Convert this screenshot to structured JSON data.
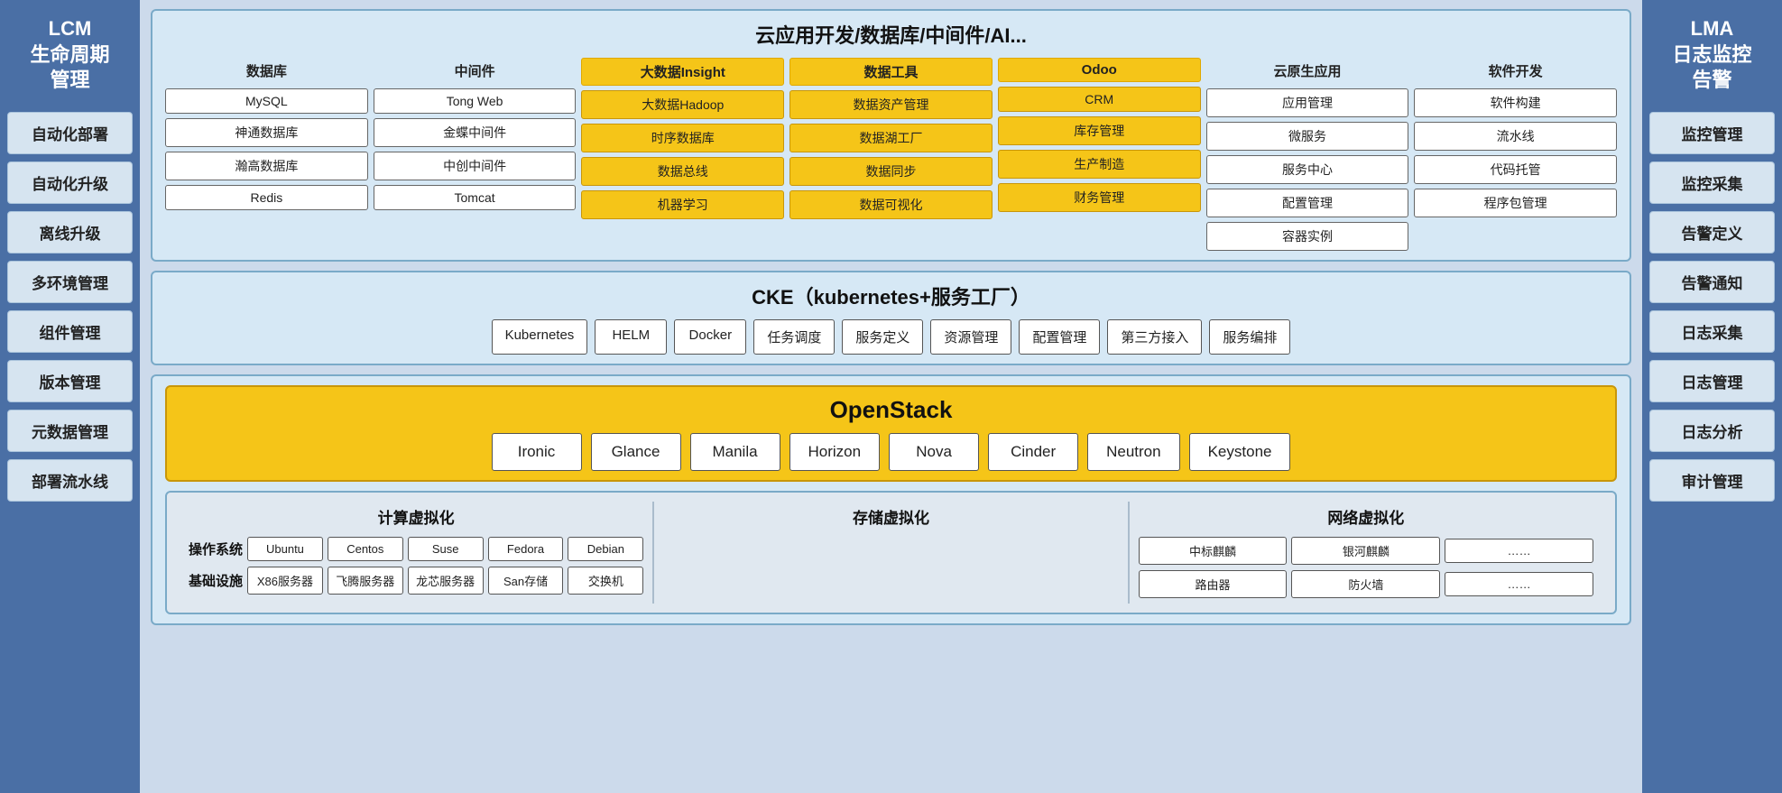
{
  "sidebar_left": {
    "title": "LCM\n生命周期\n管理",
    "items": [
      "自动化部署",
      "自动化升级",
      "离线升级",
      "多环境管理",
      "组件管理",
      "版本管理",
      "元数据管理",
      "部署流水线"
    ]
  },
  "sidebar_right": {
    "title": "LMA\n日志监控\n告警",
    "items": [
      "监控管理",
      "监控采集",
      "告警定义",
      "告警通知",
      "日志采集",
      "日志管理",
      "日志分析",
      "审计管理"
    ]
  },
  "cloud_section": {
    "title": "云应用开发/数据库/中间件/AI...",
    "columns": [
      {
        "header": "数据库",
        "header_yellow": false,
        "items": [
          "MySQL",
          "神通数据库",
          "瀚高数据库",
          "Redis"
        ]
      },
      {
        "header": "中间件",
        "header_yellow": false,
        "items": [
          "Tong Web",
          "金蝶中间件",
          "中创中间件",
          "Tomcat"
        ]
      },
      {
        "header": "大数据Insight",
        "header_yellow": true,
        "items": [
          "大数据Hadoop",
          "时序数据库",
          "数据总线",
          "机器学习"
        ],
        "items_yellow": true
      },
      {
        "header": "数据工具",
        "header_yellow": true,
        "items": [
          "数据资产管理",
          "数据湖工厂",
          "数据同步",
          "数据可视化"
        ],
        "items_yellow": true
      },
      {
        "header": "Odoo",
        "header_yellow": true,
        "items": [
          "CRM",
          "库存管理",
          "生产制造",
          "财务管理"
        ],
        "items_yellow": true
      },
      {
        "header": "云原生应用",
        "header_yellow": false,
        "items": [
          "应用管理",
          "微服务",
          "服务中心",
          "配置管理",
          "容器实例"
        ]
      },
      {
        "header": "软件开发",
        "header_yellow": false,
        "items": [
          "软件构建",
          "流水线",
          "代码托管",
          "程序包管理"
        ]
      }
    ]
  },
  "cke_section": {
    "title": "CKE（kubernetes+服务工厂）",
    "items": [
      "Kubernetes",
      "HELM",
      "Docker",
      "任务调度",
      "服务定义",
      "资源管理",
      "配置管理",
      "第三方接入",
      "服务编排"
    ]
  },
  "openstack_section": {
    "title": "OpenStack",
    "items": [
      "Ironic",
      "Glance",
      "Manila",
      "Horizon",
      "Nova",
      "Cinder",
      "Neutron",
      "Keystone"
    ]
  },
  "virt_section": {
    "columns": [
      {
        "title": "计算虚拟化",
        "os_label": "操作系统",
        "infra_label": "基础设施",
        "os_items": [
          "Ubuntu",
          "Centos",
          "Suse",
          "Fedora",
          "Debian"
        ],
        "infra_items": [
          "X86服务器",
          "飞腾服务器",
          "龙芯服务器",
          "San存储",
          "交换机"
        ]
      },
      {
        "title": "存储虚拟化",
        "os_label": "",
        "infra_label": "",
        "os_items": [],
        "infra_items": []
      },
      {
        "title": "网络虚拟化",
        "os_label": "",
        "infra_label": "",
        "os_items": [
          "中标麒麟",
          "银河麒麟",
          "……"
        ],
        "infra_items": [
          "路由器",
          "防火墙",
          "……"
        ]
      }
    ]
  }
}
